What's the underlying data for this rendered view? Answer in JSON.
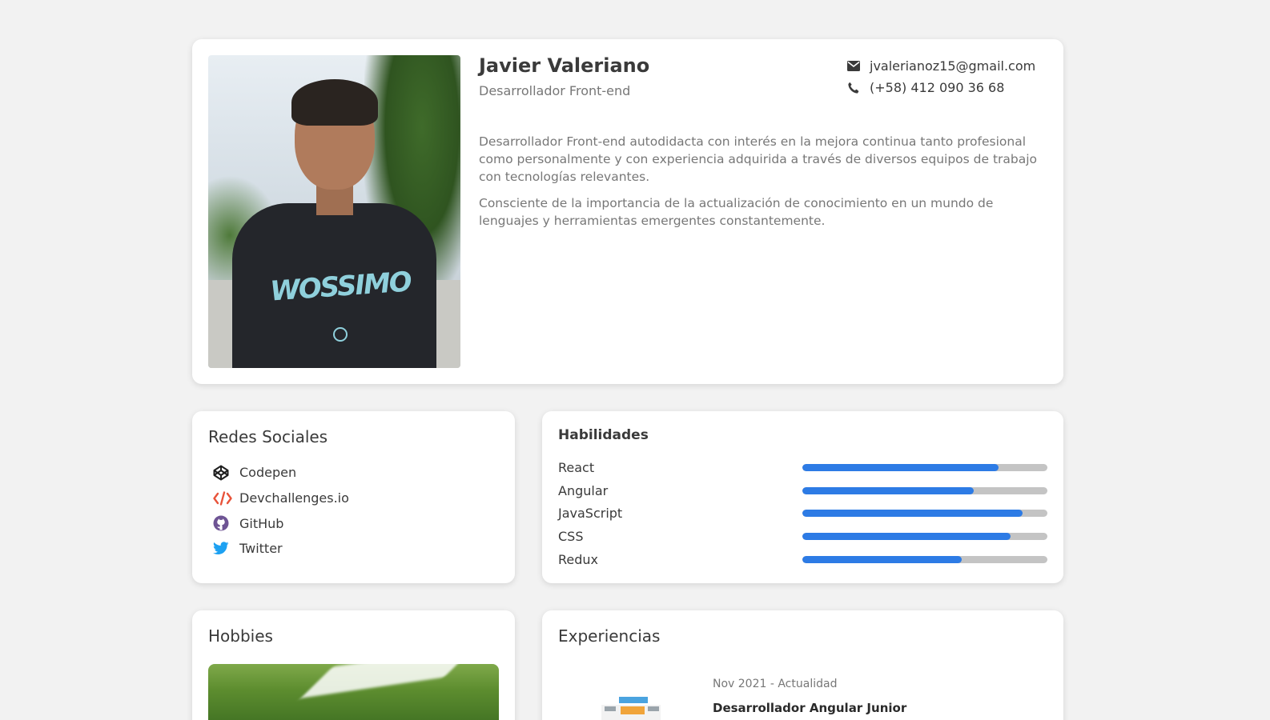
{
  "profile": {
    "name": "Javier Valeriano",
    "role": "Desarrollador Front-end",
    "email": "jvalerianoz15@gmail.com",
    "phone": "(+58) 412 090 36 68",
    "bio": [
      "Desarrollador Front-end autodidacta con interés en la mejora continua tanto profesional como personalmente y con experiencia adquirida a través de diversos equipos de trabajo con tecnologías relevantes.",
      "Consciente de la importancia de la actualización de conocimiento en un mundo de lenguajes y herramientas emergentes constantemente."
    ],
    "photo_shirt_text": "WOSSIMO",
    "email_icon": "envelope-icon",
    "phone_icon": "phone-icon"
  },
  "social": {
    "title": "Redes Sociales",
    "items": [
      {
        "label": "Codepen",
        "icon": "codepen-icon",
        "color": "#1e1e1e"
      },
      {
        "label": "Devchallenges.io",
        "icon": "code-brackets-icon",
        "color": "#e8533a"
      },
      {
        "label": "GitHub",
        "icon": "github-icon",
        "color": "#6e5494"
      },
      {
        "label": "Twitter",
        "icon": "twitter-icon",
        "color": "#1da1f2"
      }
    ]
  },
  "skills": {
    "title": "Habilidades",
    "bar_color": "#2d7be5",
    "track_color": "#c4c4c4",
    "items": [
      {
        "name": "React",
        "level": 0.8
      },
      {
        "name": "Angular",
        "level": 0.7
      },
      {
        "name": "JavaScript",
        "level": 0.9
      },
      {
        "name": "CSS",
        "level": 0.85
      },
      {
        "name": "Redux",
        "level": 0.65
      }
    ]
  },
  "hobbies": {
    "title": "Hobbies"
  },
  "experience": {
    "title": "Experiencias",
    "items": [
      {
        "date": "Nov 2021 - Actualidad",
        "title": "Desarrollador Angular Junior"
      }
    ]
  }
}
